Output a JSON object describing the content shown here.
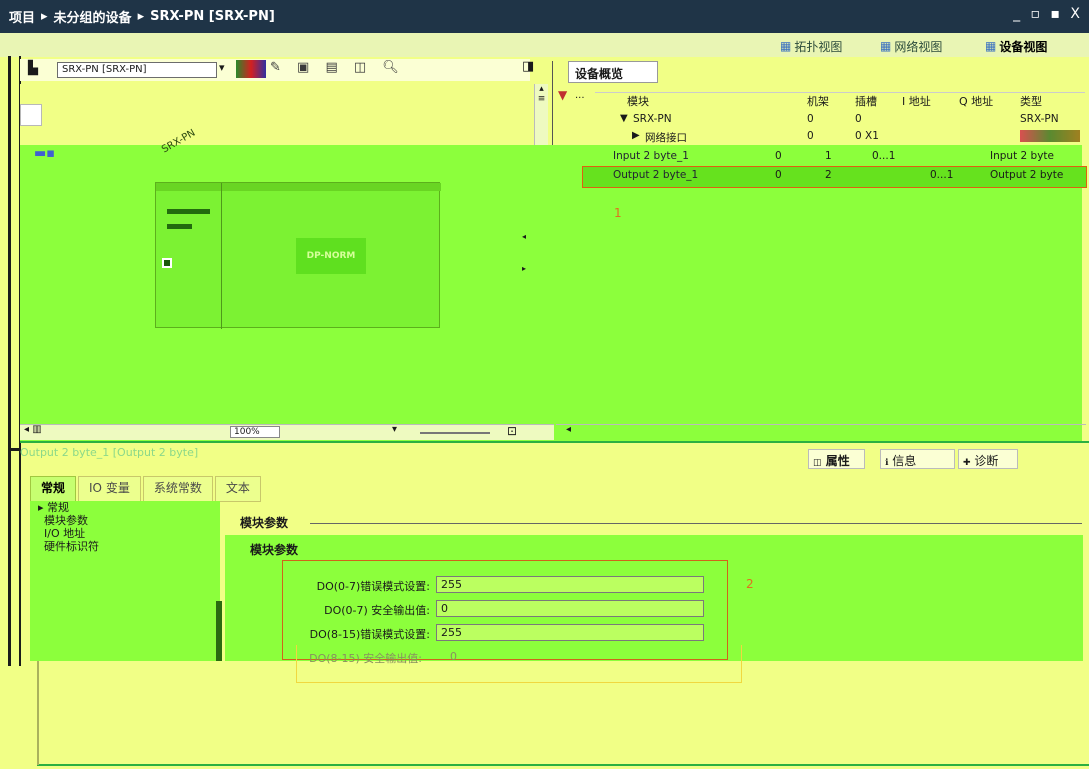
{
  "titlebar": {
    "breadcrumb": [
      "项目",
      "未分组的设备",
      "SRX-PN [SRX-PN]"
    ],
    "window_controls": "_ ▫ ▪ X"
  },
  "views": {
    "topology": "拓扑视图",
    "network": "网络视图",
    "device": "设备视图"
  },
  "toolbar": {
    "device_select": "SRX-PN [SRX-PN]"
  },
  "canvas": {
    "device_label": "SRX-PN",
    "module_label": "DP-NORM",
    "zoom": "100%"
  },
  "overview": {
    "tab_label": "设备概览",
    "columns": [
      "模块",
      "机架",
      "插槽",
      "I 地址",
      "Q 地址",
      "类型"
    ],
    "rows": [
      {
        "module": "SRX-PN",
        "rack": "0",
        "slot": "0",
        "i_addr": "",
        "q_addr": "",
        "type": "SRX-PN",
        "indent": "▼"
      },
      {
        "module": "网络接口",
        "rack": "0",
        "slot": "0 X1",
        "i_addr": "",
        "q_addr": "",
        "type": "",
        "indent": "▶"
      },
      {
        "module": "Input 2 byte_1",
        "rack": "0",
        "slot": "1",
        "i_addr": "0...1",
        "q_addr": "",
        "type": "Input 2 byte",
        "indent": ""
      },
      {
        "module": "Output 2 byte_1",
        "rack": "0",
        "slot": "2",
        "i_addr": "",
        "q_addr": "0...1",
        "type": "Output 2 byte",
        "indent": ""
      }
    ],
    "annotation": "1"
  },
  "inspector": {
    "title": "Output 2 byte_1 [Output 2 byte]",
    "panel_tabs": [
      "属性",
      "信息",
      "诊断"
    ],
    "tabs": [
      "常规",
      "IO 变量",
      "系统常数",
      "文本"
    ],
    "nav": [
      "▸ 常规",
      "模块参数",
      "I/O 地址",
      "硬件标识符"
    ],
    "section_title": "模块参数",
    "subsection_title": "模块参数",
    "params": [
      {
        "label": "DO(0-7)错误模式设置:",
        "value": "255"
      },
      {
        "label": "DO(0-7) 安全输出值:",
        "value": "0"
      },
      {
        "label": "DO(8-15)错误模式设置:",
        "value": "255"
      },
      {
        "label": "DO(8-15) 安全输出值:",
        "value": "0"
      }
    ],
    "annotation": "2"
  },
  "colors": {
    "titlebar": "#1f3447",
    "highlight_green": "#8cff3c",
    "annotation_orange": "#e06010"
  }
}
